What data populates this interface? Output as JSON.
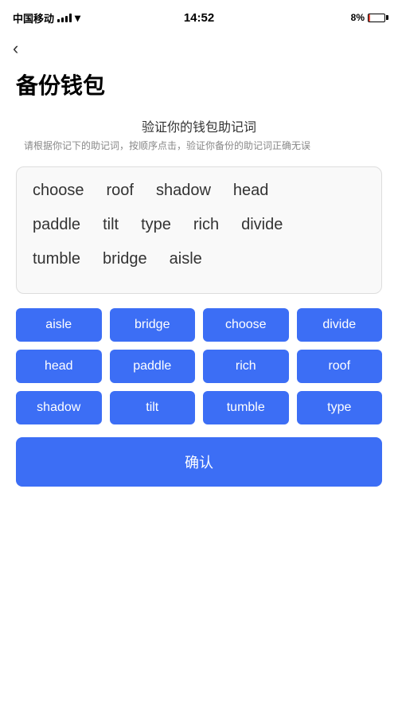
{
  "statusBar": {
    "carrier": "中国移动",
    "time": "14:52",
    "batteryPercent": "8%"
  },
  "nav": {
    "backIcon": "‹"
  },
  "page": {
    "title": "备份钱包",
    "sectionTitle": "验证你的钱包助记词",
    "sectionDesc": "请根据你记下的助记词，按顺序点击，验证你备份的助记词正确无误"
  },
  "displayWords": {
    "row1": [
      "choose",
      "roof",
      "shadow",
      "head"
    ],
    "row2": [
      "paddle",
      "tilt",
      "type",
      "rich",
      "divide"
    ],
    "row3": [
      "tumble",
      "bridge",
      "aisle"
    ]
  },
  "chips": [
    "aisle",
    "bridge",
    "choose",
    "divide",
    "head",
    "paddle",
    "rich",
    "roof",
    "shadow",
    "tilt",
    "tumble",
    "type"
  ],
  "confirmBtn": {
    "label": "确认"
  }
}
